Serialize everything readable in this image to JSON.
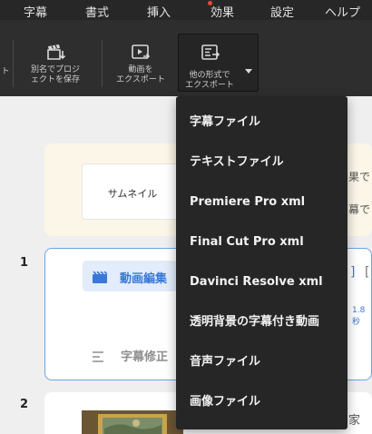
{
  "menu": {
    "items": [
      "字幕",
      "書式",
      "挿入",
      "効果",
      "設定",
      "ヘルプ"
    ]
  },
  "toolbar": {
    "partial_left_label": "ト",
    "save_as_label": "別名でプロジ\nェクトを保存",
    "export_video_label": "動画を\nエクスポート",
    "other_export_label": "他の形式で\nエクスポート"
  },
  "dropdown": {
    "items": [
      "字幕ファイル",
      "テキストファイル",
      "Premiere Pro xml",
      "Final Cut Pro xml",
      "Davinci Resolve xml",
      "透明背景の字幕付き動画",
      "音声ファイル",
      "画像ファイル"
    ]
  },
  "content": {
    "thumbnail_label": "サムネイル",
    "banner_right_1": "果で",
    "banner_right_2": "幕で",
    "row1_number": "1",
    "row2_number": "2",
    "video_edit_label": "動画編集",
    "subtitle_fix_label": "字幕修正",
    "bracket_frag": "]",
    "bracket_frag2": "[",
    "duration_frag": "1.8秒",
    "row2_right_frag": "家"
  },
  "colors": {
    "accent_blue": "#3978d6",
    "menu_dot": "#e8473a"
  }
}
